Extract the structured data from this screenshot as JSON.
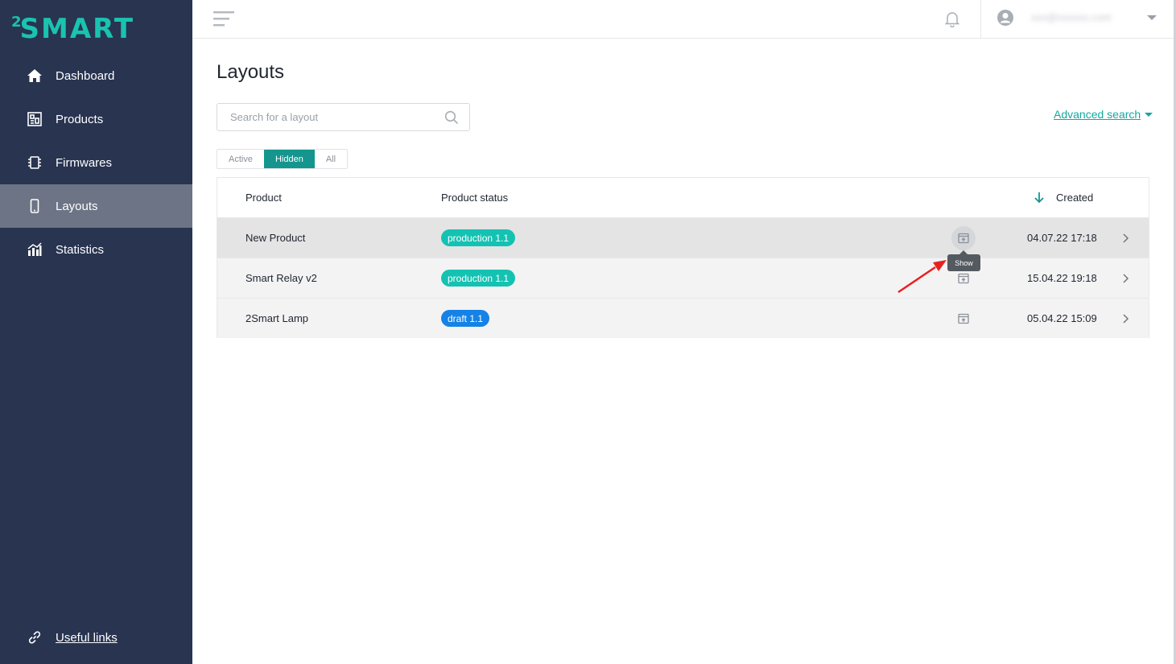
{
  "app": {
    "logo": "2SMART"
  },
  "sidebar": {
    "items": [
      {
        "label": "Dashboard",
        "icon": "home-icon",
        "active": false
      },
      {
        "label": "Products",
        "icon": "products-icon",
        "active": false
      },
      {
        "label": "Firmwares",
        "icon": "chip-icon",
        "active": false
      },
      {
        "label": "Layouts",
        "icon": "phone-icon",
        "active": true
      },
      {
        "label": "Statistics",
        "icon": "bar-chart-icon",
        "active": false
      }
    ],
    "footer_link": {
      "label": "Useful links",
      "icon": "link-icon"
    }
  },
  "topbar": {
    "user_email": "xxx@xxxxxx.com"
  },
  "page": {
    "title": "Layouts",
    "search_placeholder": "Search for a layout",
    "advanced_search": "Advanced search",
    "filters": [
      {
        "label": "Active",
        "active": false
      },
      {
        "label": "Hidden",
        "active": true
      },
      {
        "label": "All",
        "active": false
      }
    ]
  },
  "table": {
    "columns": {
      "product": "Product",
      "status": "Product status",
      "created": "Created"
    },
    "sort": "created-desc",
    "rows": [
      {
        "product": "New Product",
        "status": "production 1.1",
        "status_type": "production",
        "created": "04.07.22 17:18"
      },
      {
        "product": "Smart Relay v2",
        "status": "production 1.1",
        "status_type": "production",
        "created": "15.04.22 19:18"
      },
      {
        "product": "2Smart Lamp",
        "status": "draft 1.1",
        "status_type": "draft",
        "created": "05.04.22 15:09"
      }
    ]
  },
  "tooltip": {
    "label": "Show"
  },
  "colors": {
    "sidebar_bg": "#283450",
    "accent": "#14958d",
    "production_badge": "#14c2b2",
    "draft_badge": "#1482e6",
    "annotation_arrow": "#e82020"
  }
}
